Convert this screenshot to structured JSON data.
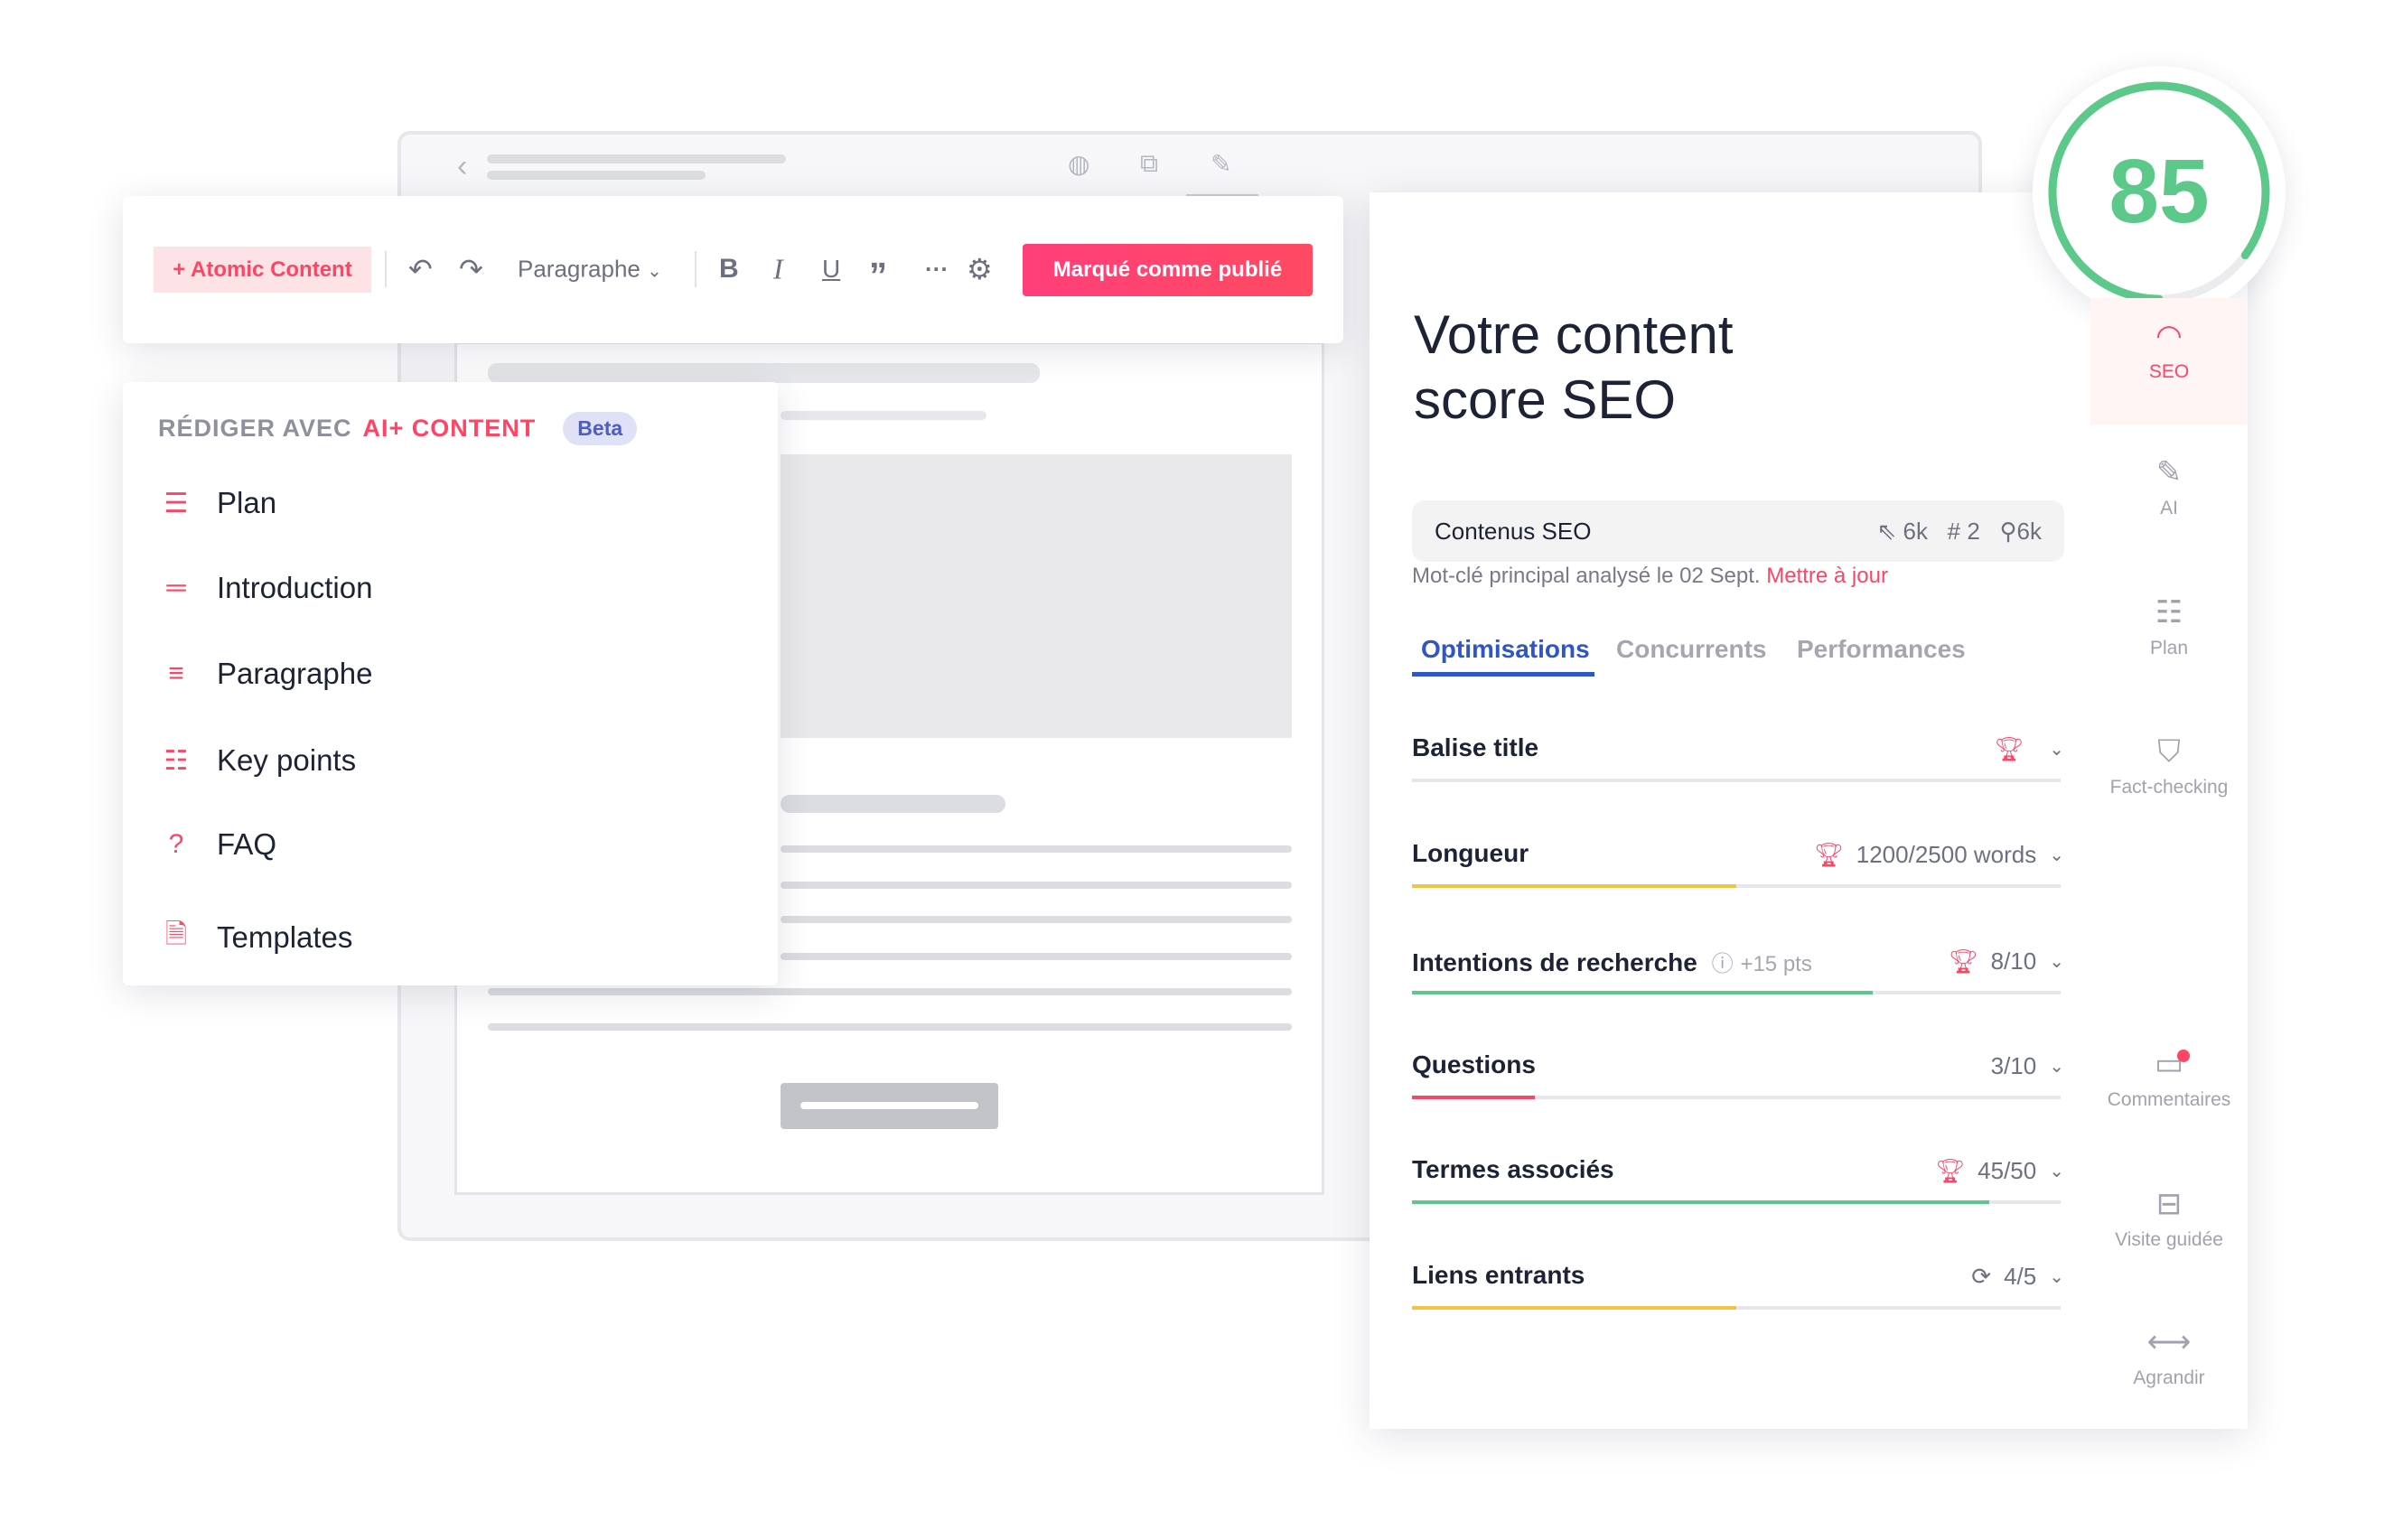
{
  "toolbar": {
    "atomic_label": "+ Atomic Content",
    "style_select": "Paragraphe",
    "publish_label": "Marqué comme publié"
  },
  "ai_menu": {
    "header_prefix": "RÉDIGER AVEC",
    "header_brand": "AI+ CONTENT",
    "badge": "Beta",
    "items": [
      {
        "label": "Plan",
        "icon": "list-icon"
      },
      {
        "label": "Introduction",
        "icon": "lines-icon"
      },
      {
        "label": "Paragraphe",
        "icon": "paragraph-icon"
      },
      {
        "label": "Key points",
        "icon": "key-points-icon"
      },
      {
        "label": "FAQ",
        "icon": "question-icon"
      },
      {
        "label": "Templates",
        "icon": "template-icon"
      }
    ]
  },
  "seo": {
    "score": "85",
    "title_line1": "Votre content",
    "title_line2": "score SEO",
    "keyword": "Contenus SEO",
    "clicks": "6k",
    "rank": "# 2",
    "volume": "6k",
    "analysis_text": "Mot-clé principal analysé le 02 Sept.",
    "update_link": "Mettre à jour",
    "tabs": [
      "Optimisations",
      "Concurrents",
      "Performances"
    ],
    "active_tab": "Optimisations",
    "rows": [
      {
        "label": "Balise title",
        "value": "",
        "progress": 0,
        "color": "#e6e7ea",
        "icon": "trophy-icon"
      },
      {
        "label": "Longueur",
        "value": "1200/2500 words",
        "progress": 0.5,
        "color": "#f5c342",
        "icon": "trophy-icon"
      },
      {
        "label": "Intentions de recherche",
        "extra": "+15 pts",
        "value": "8/10",
        "progress": 0.71,
        "color": "#5cc98a",
        "icon": "trophy-icon"
      },
      {
        "label": "Questions",
        "value": "3/10",
        "progress": 0.19,
        "color": "#ff4566",
        "icon": ""
      },
      {
        "label": "Termes associés",
        "value": "45/50",
        "progress": 0.89,
        "color": "#5cc98a",
        "icon": "trophy-icon"
      },
      {
        "label": "Liens entrants",
        "value": "4/5",
        "progress": 0.5,
        "color": "#f5c342",
        "icon": "refresh-icon"
      }
    ]
  },
  "sidebar": {
    "items": [
      {
        "label": "SEO",
        "active": true
      },
      {
        "label": "AI"
      },
      {
        "label": "Plan"
      },
      {
        "label": "Fact-checking"
      },
      {
        "label": "Commentaires",
        "notification": true
      },
      {
        "label": "Visite guidée"
      },
      {
        "label": "Agrandir"
      }
    ]
  },
  "colors": {
    "accent": "#ff4566",
    "score": "#5cc98a",
    "tab_active": "#2f55c8"
  }
}
